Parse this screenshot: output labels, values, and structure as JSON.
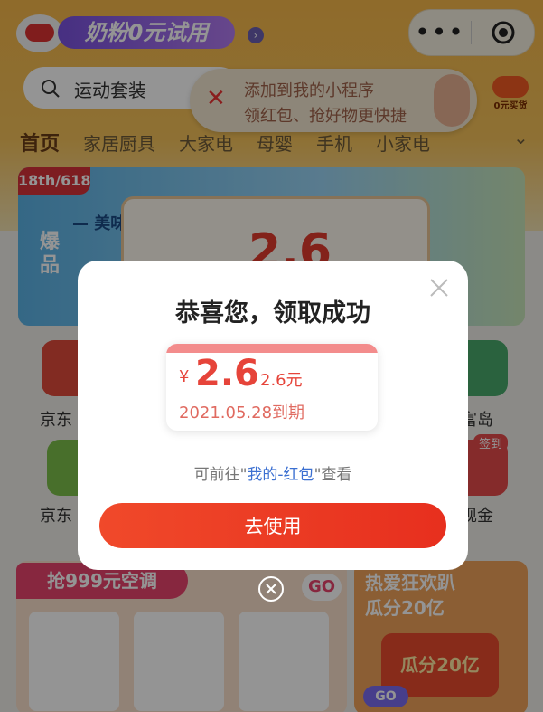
{
  "header": {
    "banner_title": "奶粉0元试用",
    "search_placeholder": "运动套装",
    "tip_line1": "添加到我的小程序",
    "tip_line2": "领红包、抢好物更快捷",
    "corner_badge": "0元买货",
    "categories": [
      "首页",
      "家居厨具",
      "大家电",
      "母婴",
      "手机",
      "小家电"
    ]
  },
  "hero": {
    "badge": "18th/618",
    "text1": "— 美味",
    "text2": "爆品",
    "amount": "2.6"
  },
  "grid": {
    "row1": [
      "京东",
      "富岛"
    ],
    "row2": [
      "京东",
      "现金"
    ],
    "badge": "签到"
  },
  "bottom": {
    "left_title": "抢999元空调",
    "left_go": "GO",
    "right_title1": "热爱狂欢趴",
    "right_title2": "瓜分20亿",
    "right_box": "瓜分20亿",
    "right_go": "GO"
  },
  "modal": {
    "title": "恭喜您，领取成功",
    "currency": "¥",
    "amount": "2.6",
    "amount_text": "2.6元",
    "expiry": "2021.05.28到期",
    "hint_prefix": "可前往\"",
    "hint_link": "我的-红包",
    "hint_suffix": "\"查看",
    "button": "去使用"
  },
  "colors": {
    "accent": "#e6443a",
    "button": "#ee3f26",
    "link": "#3b6fd1"
  }
}
